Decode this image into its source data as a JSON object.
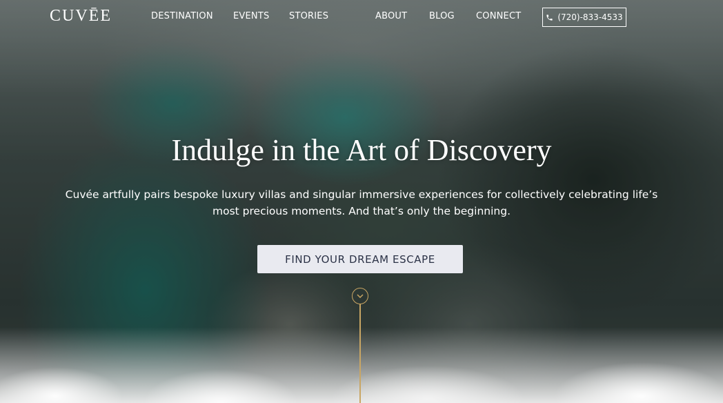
{
  "brand": {
    "logo": "CUVĒE"
  },
  "nav": {
    "links": [
      {
        "label": "DESTINATION"
      },
      {
        "label": "EVENTS"
      },
      {
        "label": "STORIES"
      },
      {
        "label": "ABOUT"
      },
      {
        "label": "BLOG"
      },
      {
        "label": "CONNECT"
      }
    ],
    "phone": "(720)-833-4533"
  },
  "hero": {
    "headline": "Indulge in the Art of Discovery",
    "subtext": "Cuvée artfully pairs bespoke luxury villas and singular immersive experiences for collectively celebrating life’s most precious moments. And that’s only the beginning.",
    "cta_label": "FIND YOUR DREAM ESCAPE"
  },
  "icons": {
    "phone": "phone-icon",
    "scroll": "chevron-down-icon"
  },
  "colors": {
    "accent_gold": "#c9a664",
    "cta_bg": "#e9eaf0",
    "cta_text": "#2b3246"
  }
}
